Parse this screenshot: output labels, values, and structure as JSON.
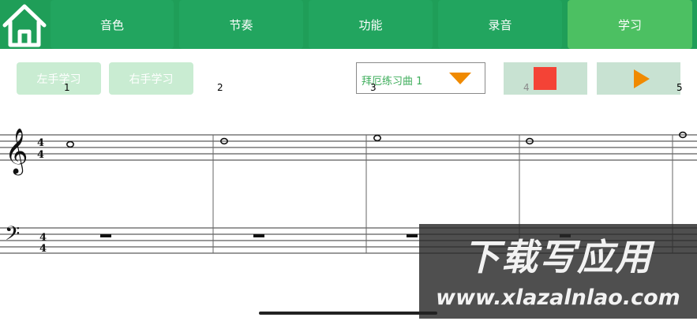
{
  "nav": {
    "tabs": [
      {
        "label": "音色"
      },
      {
        "label": "节奏"
      },
      {
        "label": "功能"
      },
      {
        "label": "录音"
      },
      {
        "label": "学习"
      }
    ],
    "active_tab": "学习"
  },
  "controls": {
    "left_hand": "左手学习",
    "right_hand": "右手学习",
    "song_select": "拜厄练习曲 1"
  },
  "measure_numbers": [
    "1",
    "2",
    "3",
    "4",
    "5"
  ],
  "score": {
    "time_signature": {
      "top": "4",
      "bottom": "4"
    }
  },
  "watermark": {
    "line1": "下载写应用",
    "line2": "www.xlazalnlao.com"
  },
  "colors": {
    "nav_bg": "#1f9e58",
    "tab": "#22a55f",
    "tab_active": "#4cc062",
    "hand_button": "#c9ecd2",
    "stop": "#f44336",
    "play": "#f08a00",
    "select_text": "#3fae5c"
  }
}
